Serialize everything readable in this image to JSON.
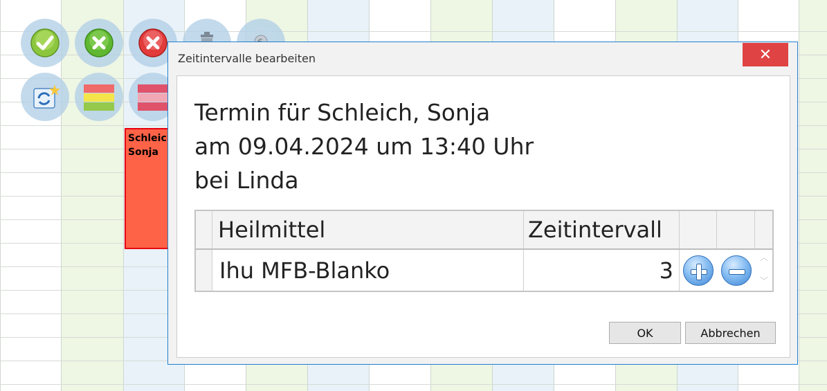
{
  "background": {
    "columns": [
      {
        "color": "green"
      },
      {
        "color": "blue"
      },
      {
        "color": "white"
      },
      {
        "color": "green"
      },
      {
        "color": "blue"
      },
      {
        "color": "white"
      },
      {
        "color": "green"
      },
      {
        "color": "blue"
      },
      {
        "color": "white"
      },
      {
        "color": "green"
      },
      {
        "color": "blue"
      },
      {
        "color": "white"
      },
      {
        "color": "green"
      }
    ],
    "appointment": {
      "line1": "Schleich,",
      "line2": "Sonja",
      "color": "#ff6347"
    }
  },
  "actions": [
    {
      "icon": "check-icon"
    },
    {
      "icon": "cancel-green-icon"
    },
    {
      "icon": "cancel-red-icon"
    },
    {
      "icon": "trash-icon"
    },
    {
      "icon": "euro-coins-icon"
    },
    {
      "icon": "refresh-new-icon"
    },
    {
      "icon": "traffic-light-icon"
    },
    {
      "icon": "red-bars-icon"
    }
  ],
  "dialog": {
    "title": "Zeitintervalle bearbeiten",
    "close_label": "✕",
    "info_line1": "Termin für Schleich, Sonja",
    "info_line2": "am 09.04.2024 um 13:40 Uhr",
    "info_line3": "bei Linda",
    "table": {
      "headers": {
        "heilmittel": "Heilmittel",
        "zeitintervall": "Zeitintervall"
      },
      "rows": [
        {
          "heilmittel": "Ihu MFB-Blanko",
          "zeitintervall": "3"
        }
      ]
    },
    "ok_label": "OK",
    "cancel_label": "Abbrechen",
    "accent_color": "#1f7fd0",
    "close_color": "#e04343"
  }
}
